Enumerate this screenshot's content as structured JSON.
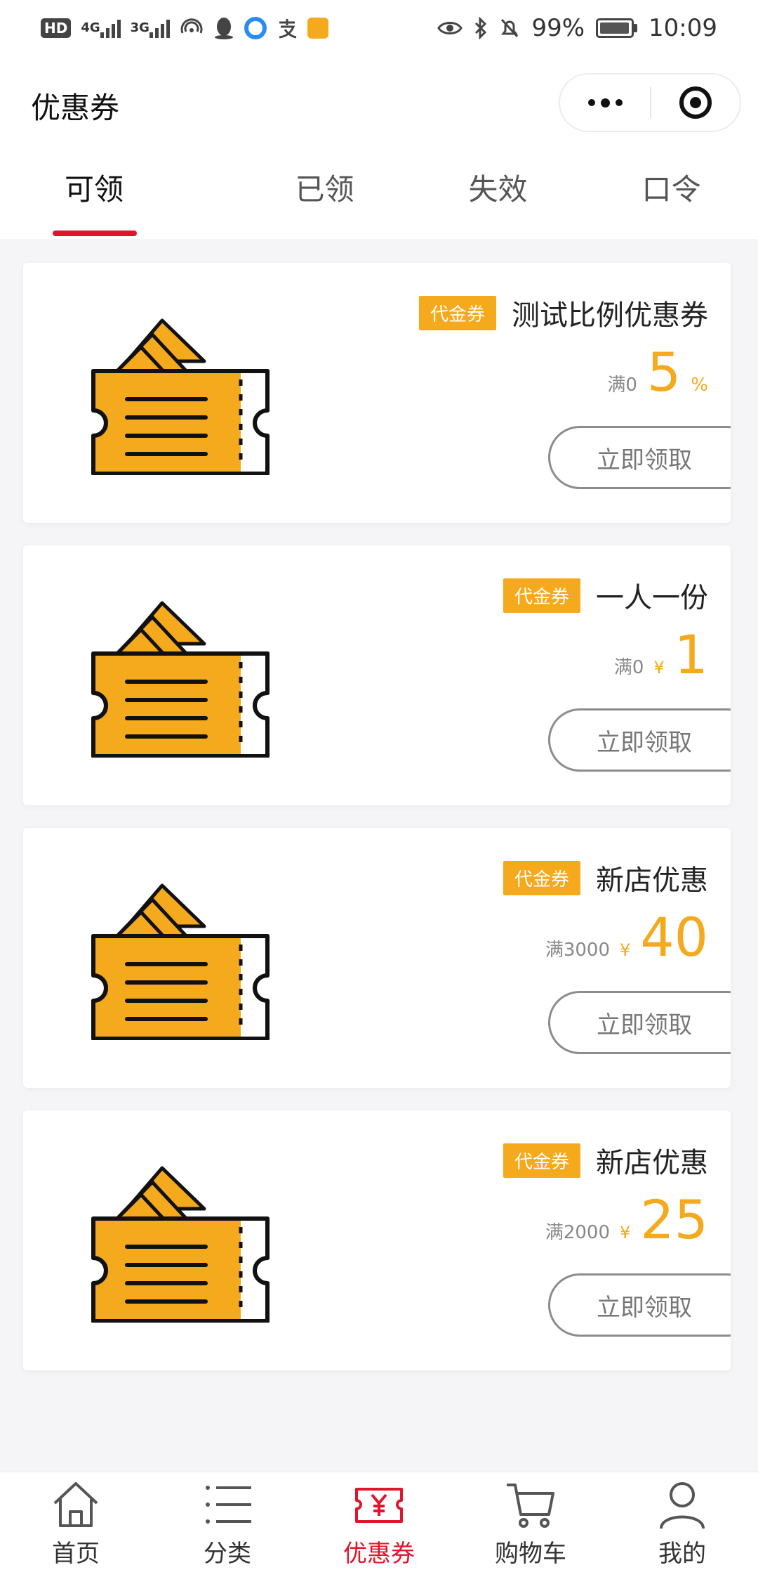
{
  "status_bar": {
    "hd": "HD",
    "net1": "4G",
    "net2": "3G",
    "battery_pct": "99%",
    "time": "10:09"
  },
  "header": {
    "title": "优惠券"
  },
  "tabs": [
    {
      "label": "可领",
      "active": true
    },
    {
      "label": "已领",
      "active": false
    },
    {
      "label": "失效",
      "active": false
    },
    {
      "label": "口令",
      "active": false
    }
  ],
  "coupons": [
    {
      "tag": "代金券",
      "name": "测试比例优惠券",
      "condition": "满0",
      "currency": "",
      "value": "5",
      "suffix": "%",
      "button": "立即领取"
    },
    {
      "tag": "代金券",
      "name": "一人一份",
      "condition": "满0",
      "currency": "¥",
      "value": "1",
      "suffix": "",
      "button": "立即领取"
    },
    {
      "tag": "代金券",
      "name": "新店优惠",
      "condition": "满3000",
      "currency": "¥",
      "value": "40",
      "suffix": "",
      "button": "立即领取"
    },
    {
      "tag": "代金券",
      "name": "新店优惠",
      "condition": "满2000",
      "currency": "¥",
      "value": "25",
      "suffix": "",
      "button": "立即领取"
    }
  ],
  "bottom_nav": [
    {
      "label": "首页",
      "icon": "home-icon",
      "active": false
    },
    {
      "label": "分类",
      "icon": "category-list-icon",
      "active": false
    },
    {
      "label": "优惠券",
      "icon": "coupon-icon",
      "active": true
    },
    {
      "label": "购物车",
      "icon": "cart-icon",
      "active": false
    },
    {
      "label": "我的",
      "icon": "profile-icon",
      "active": false
    }
  ],
  "colors": {
    "accent_red": "#e0142b",
    "coupon_orange": "#f5a91c",
    "background": "#f5f5f7"
  }
}
